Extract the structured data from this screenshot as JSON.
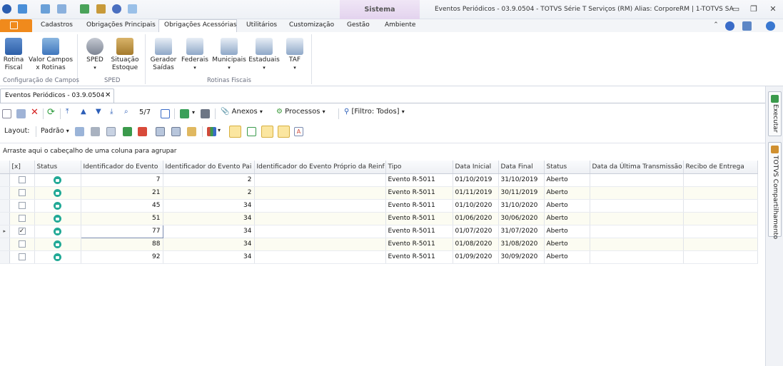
{
  "window": {
    "context_tab": "Sistema",
    "title": "Eventos Periódicos - 03.9.0504 - TOTVS Série T Serviços (RM) Alias: CorporeRM | 1-TOTVS SA"
  },
  "ribbon_tabs": [
    "Cadastros",
    "Obrigações Principais",
    "Obrigações Acessórias",
    "Utilitários",
    "Customização",
    "Gestão",
    "Ambiente"
  ],
  "ribbon": {
    "buttons": {
      "rotina": "Rotina\nFiscal",
      "valor": "Valor Campos\nx Rotinas",
      "sped": "SPED",
      "situacao": "Situação\nEstoque",
      "gerador": "Gerador\nSaídas",
      "federais": "Federais",
      "municipais": "Municipais",
      "estaduais": "Estaduais",
      "taf": "TAF"
    },
    "groups": {
      "config": "Configuração de Campos",
      "sped": "SPED",
      "rotinas": "Rotinas Fiscais"
    }
  },
  "doc_tab": {
    "label": "Eventos Periódicos - 03.9.0504",
    "close": "✕"
  },
  "toolbar": {
    "record_nav": "5/7",
    "anexos": "Anexos",
    "processos": "Processos",
    "filtro": "[Filtro: Todos]"
  },
  "layout_bar": {
    "layout_label": "Layout:",
    "padrao": "Padrão"
  },
  "group_hint": "Arraste aqui o cabeçalho de uma coluna para agrupar",
  "grid": {
    "headers": [
      "[x]",
      "Status",
      "Identificador do Evento",
      "Identificador do Evento Pai",
      "Identificador do Evento Próprio da Reinf",
      "Tipo",
      "Data Inicial",
      "Data Final",
      "Status",
      "Data da Última Transmissão",
      "Recibo de Entrega"
    ],
    "rows": [
      {
        "checked": false,
        "id": "7",
        "pai": "2",
        "proprio": "",
        "tipo": "Evento R-5011",
        "inicio": "01/10/2019",
        "fim": "31/10/2019",
        "status": "Aberto",
        "transmissao": "",
        "recibo": ""
      },
      {
        "checked": false,
        "id": "21",
        "pai": "2",
        "proprio": "",
        "tipo": "Evento R-5011",
        "inicio": "01/11/2019",
        "fim": "30/11/2019",
        "status": "Aberto",
        "transmissao": "",
        "recibo": ""
      },
      {
        "checked": false,
        "id": "45",
        "pai": "34",
        "proprio": "",
        "tipo": "Evento R-5011",
        "inicio": "01/10/2020",
        "fim": "31/10/2020",
        "status": "Aberto",
        "transmissao": "",
        "recibo": ""
      },
      {
        "checked": false,
        "id": "51",
        "pai": "34",
        "proprio": "",
        "tipo": "Evento R-5011",
        "inicio": "01/06/2020",
        "fim": "30/06/2020",
        "status": "Aberto",
        "transmissao": "",
        "recibo": ""
      },
      {
        "checked": true,
        "id": "77",
        "pai": "34",
        "proprio": "",
        "tipo": "Evento R-5011",
        "inicio": "01/07/2020",
        "fim": "31/07/2020",
        "status": "Aberto",
        "transmissao": "",
        "recibo": ""
      },
      {
        "checked": false,
        "id": "88",
        "pai": "34",
        "proprio": "",
        "tipo": "Evento R-5011",
        "inicio": "01/08/2020",
        "fim": "31/08/2020",
        "status": "Aberto",
        "transmissao": "",
        "recibo": ""
      },
      {
        "checked": false,
        "id": "92",
        "pai": "34",
        "proprio": "",
        "tipo": "Evento R-5011",
        "inicio": "01/09/2020",
        "fim": "30/09/2020",
        "status": "Aberto",
        "transmissao": "",
        "recibo": ""
      }
    ]
  },
  "side_panels": {
    "executar": "Executar",
    "compartilhamento": "TOTVS Compartilhamento"
  },
  "colors": {
    "file_tab": "#f08a1c",
    "status_ok": "#22a996",
    "context_tab": "#e3d3ee"
  }
}
